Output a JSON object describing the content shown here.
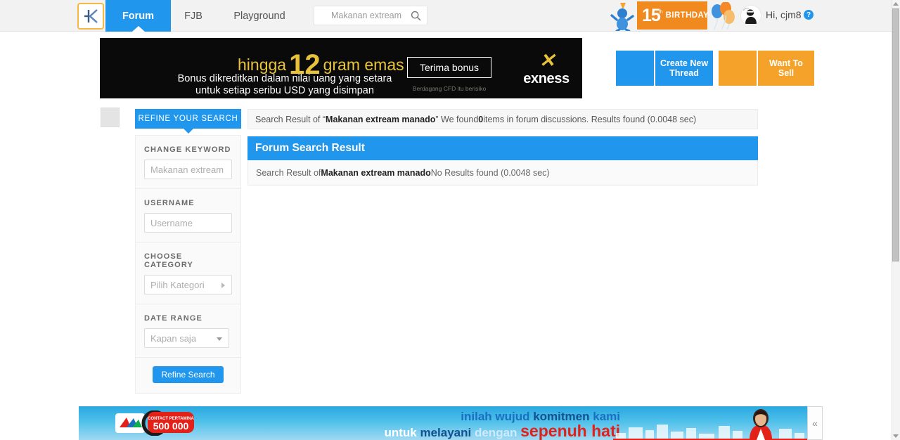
{
  "header": {
    "logo_alt": "kaskus-logo",
    "nav": [
      {
        "label": "Forum",
        "active": true
      },
      {
        "label": "FJB",
        "active": false
      },
      {
        "label": "Playground",
        "active": false
      }
    ],
    "search": {
      "value": "",
      "placeholder": "Makanan extream",
      "icon": "search-icon"
    },
    "birthday": {
      "number": "15",
      "ordinal": "th",
      "word": "BIRTHDAY"
    },
    "greeting": "Hi, cjm8",
    "help_label": "?"
  },
  "ad_banner": {
    "headline_prefix": "hingga",
    "headline_number": "12",
    "headline_suffix": "gram emas",
    "subtext_line1": "Bonus dikreditkan dalam nilai uang yang setara",
    "subtext_line2": "untuk setiap seribu USD yang disimpan",
    "cta": "Terima bonus",
    "risk_note": "Berdagang CFD itu berisiko",
    "brand_mark": "✕",
    "brand_name": "exness",
    "accent_color": "#e8c33a"
  },
  "actions": [
    {
      "label": "Create New Thread",
      "color": "#2196ed",
      "icon": "pencil-icon"
    },
    {
      "label": "Want To Sell",
      "color": "#f5a22a",
      "icon": "tag-icon"
    }
  ],
  "refine": {
    "tab_label": "REFINE YOUR SEARCH",
    "fields": [
      {
        "label": "CHANGE KEYWORD",
        "type": "text",
        "value": "",
        "placeholder": "Makanan extream manado"
      },
      {
        "label": "USERNAME",
        "type": "text",
        "value": "",
        "placeholder": "Username"
      },
      {
        "label": "CHOOSE CATEGORY",
        "type": "select-right",
        "value": "Pilih Kategori"
      },
      {
        "label": "DATE RANGE",
        "type": "select-down",
        "value": "Kapan saja"
      }
    ],
    "submit_label": "Refine Search"
  },
  "results": {
    "summary_prefix": "Search Result of “",
    "summary_query": "Makanan extream manado",
    "summary_mid": "” We found ",
    "summary_count": "0",
    "summary_suffix": " items in forum discussions. Results found (0.0048 sec)",
    "panel_title": "Forum Search Result",
    "body_prefix": "Search Result of ",
    "body_query": "Makanan extream manado",
    "body_suffix": " No Results found (0.0048 sec)"
  },
  "bottom_banner": {
    "logo_caption_small": "CONTACT PERTAMINA",
    "logo_number": "500 000",
    "line1_a": "inilah wujud ",
    "line1_b": "komitmen ",
    "line1_c": "kami",
    "line2_a": "untuk ",
    "line2_b": "melayani ",
    "line2_c": "dengan ",
    "line2_d": "sepenuh hati",
    "collapse_icon": "«"
  },
  "scrollbar": {
    "up_arrow": "scroll-up-arrow",
    "down_arrow": "scroll-down-arrow"
  }
}
